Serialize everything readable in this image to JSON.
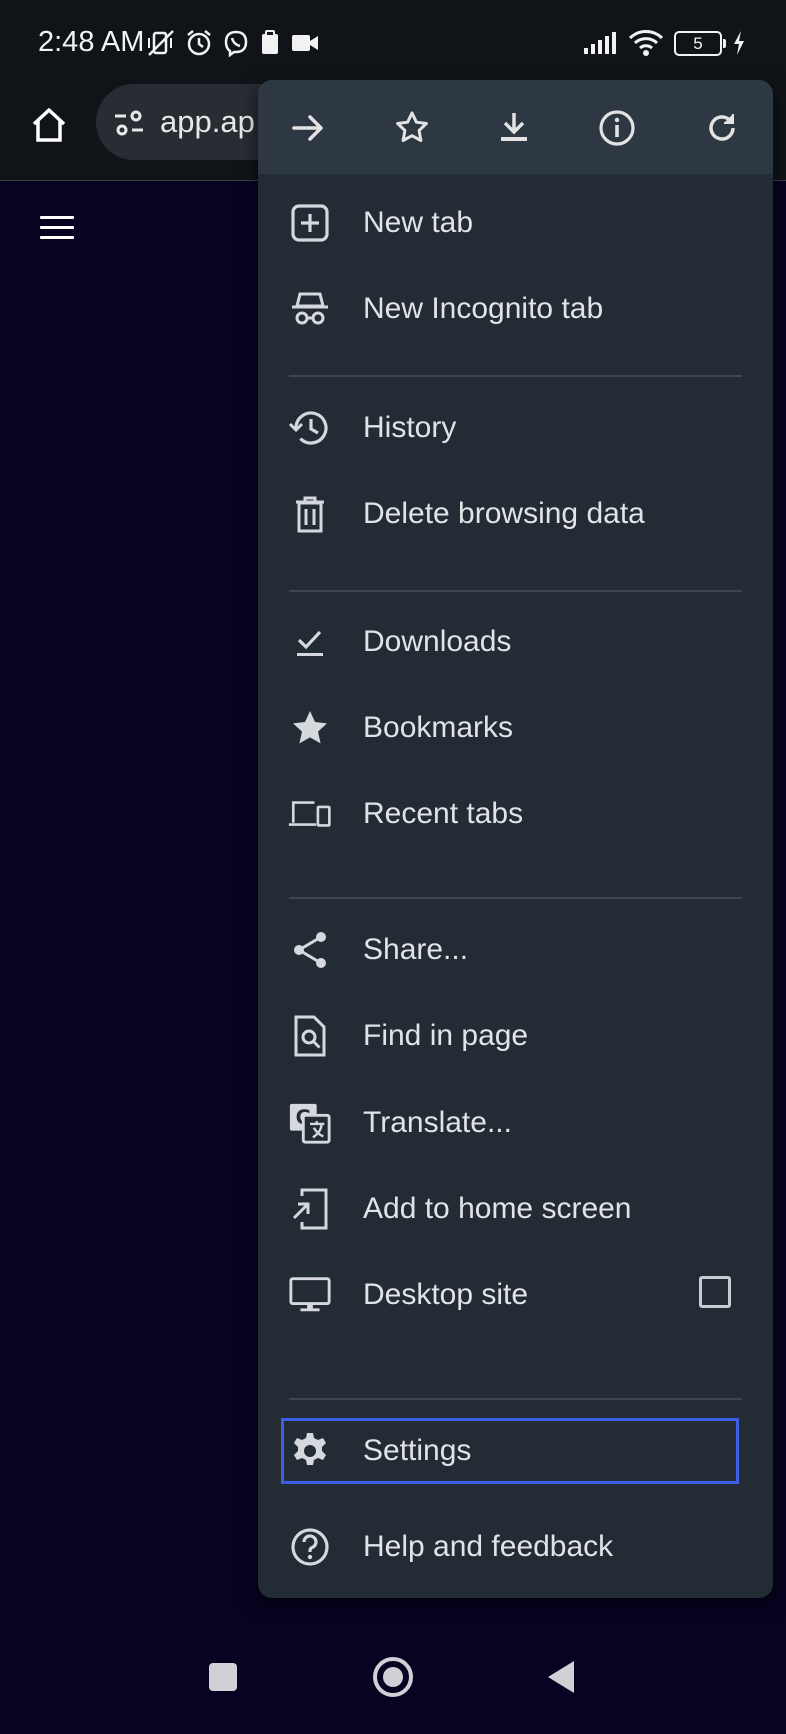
{
  "status_bar": {
    "time": "2:48 AM",
    "battery_level": "5",
    "icons_left": [
      "mute-vibrate-icon",
      "alarm-icon",
      "viber-icon",
      "clipboard-icon",
      "video-camera-icon"
    ],
    "icons_right": [
      "signal-icon",
      "wifi-icon",
      "battery-icon",
      "charging-icon"
    ]
  },
  "toolbar": {
    "url_text": "app.ap",
    "home_icon": "home-icon",
    "tune_icon": "site-settings-icon"
  },
  "menu": {
    "top_row": [
      "forward-icon",
      "bookmark-star-icon",
      "download-icon",
      "info-icon",
      "reload-icon"
    ],
    "groups": [
      [
        {
          "label": "New tab",
          "icon": "new-tab-icon"
        },
        {
          "label": "New Incognito tab",
          "icon": "incognito-icon"
        }
      ],
      [
        {
          "label": "History",
          "icon": "history-icon"
        },
        {
          "label": "Delete browsing data",
          "icon": "trash-icon"
        }
      ],
      [
        {
          "label": "Downloads",
          "icon": "downloads-check-icon"
        },
        {
          "label": "Bookmarks",
          "icon": "star-icon"
        },
        {
          "label": "Recent tabs",
          "icon": "devices-icon"
        }
      ],
      [
        {
          "label": "Share...",
          "icon": "share-icon"
        },
        {
          "label": "Find in page",
          "icon": "find-in-page-icon"
        },
        {
          "label": "Translate...",
          "icon": "translate-icon"
        },
        {
          "label": "Add to home screen",
          "icon": "add-to-home-icon"
        },
        {
          "label": "Desktop site",
          "icon": "desktop-icon",
          "checkbox_checked": false
        }
      ],
      [
        {
          "label": "Settings",
          "icon": "gear-icon",
          "focused": true
        },
        {
          "label": "Help and feedback",
          "icon": "help-icon"
        }
      ]
    ]
  },
  "colors": {
    "page_background": "#070320",
    "menu_background": "#232b34",
    "menu_top_row": "#2d3843",
    "focus_ring": "#3d5de6"
  }
}
